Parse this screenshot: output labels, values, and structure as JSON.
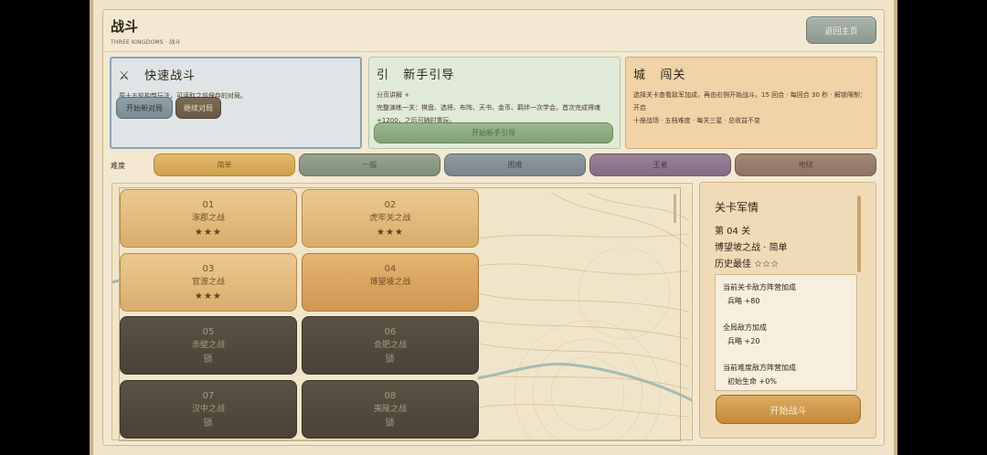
{
  "header": {
    "title": "战斗",
    "subtitle": "THREE KINGDOMS · 战斗",
    "home_label": "返回主页"
  },
  "quick_battle": {
    "icon": "crossed-swords-icon",
    "icon_glyph": "⚔",
    "title": "快速战斗",
    "desc": "原十五轮构筑玩法，可读取之前保存的对局。",
    "new_label": "开始新对局",
    "continue_label": "继续对局"
  },
  "tutorial": {
    "glyph": "引",
    "title": "新手引导",
    "desc1": "分页讲解 +",
    "desc2": "完整演练一关：棋盘、选将、布阵、天书、金币、羁绊一次学会。首次完成得魂+1200，之后可随时重玩。",
    "start_label": "开始新手引导"
  },
  "clash": {
    "glyph": "城",
    "title": "闯关",
    "desc1": "选择关卡查看敌军加成，再由右侧开始战斗。15 回合 · 每回合 30 秒 · 解锁限制：开启",
    "desc2": "十座战场 · 五档难度 · 每关三星 · 总收益不变"
  },
  "difficulty": {
    "label": "难度",
    "options": [
      "简单",
      "一般",
      "困难",
      "王者",
      "地狱"
    ],
    "selected": "简单"
  },
  "levels": [
    {
      "num": "01",
      "name": "涿郡之战",
      "status": "★★★",
      "state": "open"
    },
    {
      "num": "02",
      "name": "虎牢关之战",
      "status": "★★★",
      "state": "open"
    },
    {
      "num": "03",
      "name": "官渡之战",
      "status": "★★★",
      "state": "open"
    },
    {
      "num": "04",
      "name": "博望坡之战",
      "status": "☆☆☆",
      "state": "current"
    },
    {
      "num": "05",
      "name": "赤壁之战",
      "status": "锁",
      "state": "locked"
    },
    {
      "num": "06",
      "name": "合肥之战",
      "status": "锁",
      "state": "locked"
    },
    {
      "num": "07",
      "name": "汉中之战",
      "status": "锁",
      "state": "locked"
    },
    {
      "num": "08",
      "name": "夷陵之战",
      "status": "锁",
      "state": "locked"
    }
  ],
  "intel": {
    "title": "关卡军情",
    "level_line": "第 04 关",
    "battle_line": "博望坡之战 · 简单",
    "best_line": "历史最佳 ☆☆☆",
    "bonus": [
      {
        "label": "当前关卡敌方阵营加成",
        "value": "兵略 +80"
      },
      {
        "label": "全局敌方加成",
        "value": "兵略 +20"
      },
      {
        "label": "当前难度敌方阵营加成",
        "value": "初始生命 +0%"
      }
    ],
    "start_label": "开始战斗"
  },
  "colors": {
    "accent": "#cf9f4b",
    "background": "#f3e9d2",
    "locked": "#4a4237"
  }
}
